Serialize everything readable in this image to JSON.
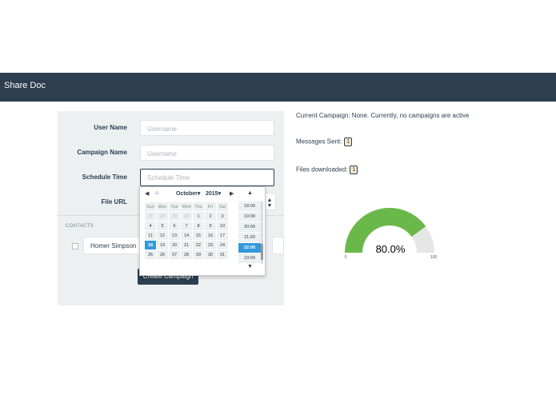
{
  "header": {
    "brand": "Share Doc"
  },
  "form": {
    "user_name_label": "User Name",
    "user_name_placeholder": "Username",
    "campaign_name_label": "Campaign Name",
    "campaign_name_placeholder": "Username",
    "schedule_time_label": "Schedule Time",
    "schedule_time_placeholder": "Schedule Time",
    "file_url_label": "File URL",
    "contacts_header": "CONTACTS",
    "contact_name": "Homer Simpson",
    "create_button": "Create Campaign"
  },
  "datepicker": {
    "month": "October",
    "year": "2015",
    "weekdays": [
      "Sun",
      "Mon",
      "Tue",
      "Wed",
      "Thu",
      "Fri",
      "Sat"
    ],
    "weeks": [
      [
        "27",
        "28",
        "29",
        "30",
        "1",
        "2",
        "3"
      ],
      [
        "4",
        "5",
        "6",
        "7",
        "8",
        "9",
        "10"
      ],
      [
        "11",
        "12",
        "13",
        "14",
        "15",
        "16",
        "17"
      ],
      [
        "18",
        "19",
        "20",
        "21",
        "22",
        "23",
        "24"
      ],
      [
        "25",
        "26",
        "27",
        "28",
        "29",
        "30",
        "31"
      ]
    ],
    "selected_day": "18",
    "times": [
      "18:00",
      "19:00",
      "20:00",
      "21:00",
      "22:00",
      "23:00"
    ],
    "selected_time": "22:00"
  },
  "status": {
    "current_campaign": "Current Campaign: None. Currently, no campaigns are active",
    "messages_sent_label": "Messages Sent:",
    "messages_sent_value": "1",
    "files_downloaded_label": "Files downloaded:",
    "files_downloaded_value": "1"
  },
  "gauge": {
    "value_text": "80.0%",
    "value": 80,
    "min_label": "0",
    "max_label": "100",
    "fill_color": "#6bb84a",
    "track_color": "#e6e6e6"
  }
}
